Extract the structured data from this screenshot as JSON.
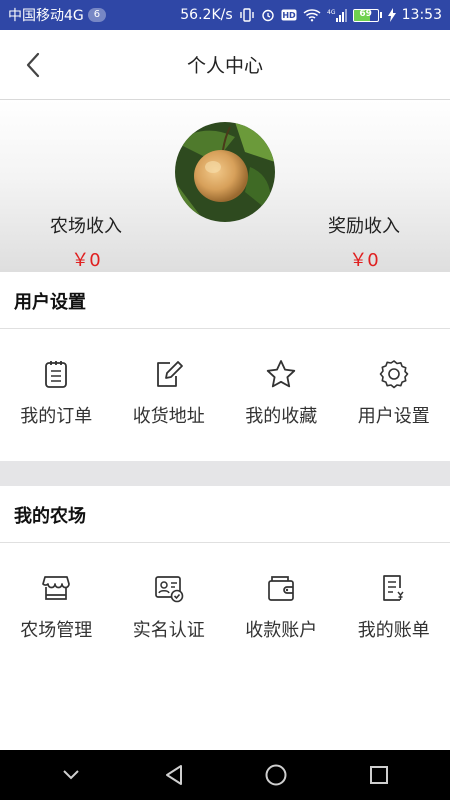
{
  "status_bar": {
    "carrier": "中国移动4G",
    "notification_count": "6",
    "network_speed": "56.2K/s",
    "network_type": "4G",
    "battery_level": "69",
    "time": "13:53"
  },
  "header": {
    "title": "个人中心",
    "back_icon": "chevron-left-icon"
  },
  "profile": {
    "farm_income_label": "农场收入",
    "farm_income_value": "￥0",
    "reward_income_label": "奖励收入",
    "reward_income_value": "￥0"
  },
  "user_settings_section": {
    "title": "用户设置",
    "items": [
      {
        "label": "我的订单",
        "icon": "clipboard-list-icon"
      },
      {
        "label": "收货地址",
        "icon": "edit-note-icon"
      },
      {
        "label": "我的收藏",
        "icon": "star-icon"
      },
      {
        "label": "用户设置",
        "icon": "gear-icon"
      }
    ]
  },
  "my_farm_section": {
    "title": "我的农场",
    "items": [
      {
        "label": "农场管理",
        "icon": "storefront-icon"
      },
      {
        "label": "实名认证",
        "icon": "id-card-check-icon"
      },
      {
        "label": "收款账户",
        "icon": "wallet-icon"
      },
      {
        "label": "我的账单",
        "icon": "bill-icon"
      }
    ]
  },
  "colors": {
    "status_bar_bg": "#2f47a6",
    "income_value": "#e02020",
    "battery_fill": "#6fd14f"
  }
}
